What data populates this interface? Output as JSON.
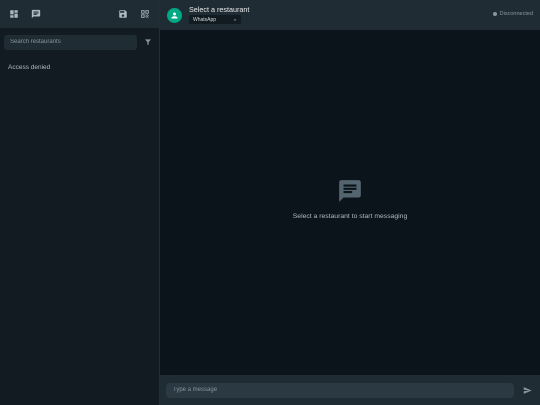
{
  "sidebar": {
    "header_icons": [
      "dashboard-icon",
      "chat-icon",
      "save-icon",
      "qr-code-icon"
    ],
    "search": {
      "placeholder": "Search restaurants",
      "value": ""
    },
    "filter_icon": "filter-icon",
    "message": "Access denied"
  },
  "header": {
    "avatar_icon": "person-icon",
    "title": "Select a restaurant",
    "channel": {
      "selected": "WhatsApp"
    },
    "status": "Disconnected"
  },
  "main": {
    "empty_icon": "chat-bubble-icon",
    "empty_message": "Select a restaurant to start messaging"
  },
  "composer": {
    "placeholder": "Type a message",
    "value": "",
    "send_icon": "send-icon"
  },
  "colors": {
    "accent": "#00a884",
    "panel": "#202c33",
    "background": "#111b21",
    "chat_background": "#0b141a"
  }
}
